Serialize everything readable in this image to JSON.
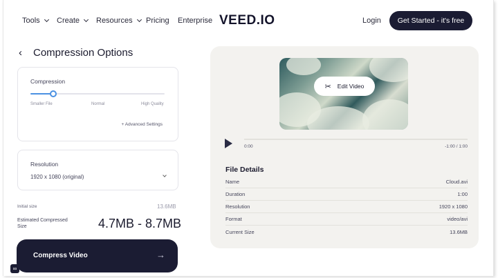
{
  "nav": {
    "tools": "Tools",
    "create": "Create",
    "resources": "Resources",
    "pricing": "Pricing",
    "enterprise": "Enterprise",
    "logo": "VEED.IO",
    "login": "Login",
    "get_started": "Get Started - it's free"
  },
  "left": {
    "title": "Compression Options",
    "compression": {
      "label": "Compression",
      "slider_fraction": 0.17,
      "ticks": [
        "Smaller File",
        "Normal",
        "High Quality"
      ],
      "advanced": "+ Advanced Settings"
    },
    "resolution": {
      "label": "Resolution",
      "selected": "1920 x 1080 (original)"
    },
    "initial_size_label": "Initial size",
    "initial_size_value": "13.6MB",
    "estimated_label": "Estimated Compressed Size",
    "estimated_value": "4.7MB - 8.7MB",
    "compress_button": "Compress Video"
  },
  "preview": {
    "edit_video": "Edit Video",
    "time_current": "0:00",
    "time_total": "-1:00 / 1:00"
  },
  "file_details": {
    "title": "File Details",
    "rows": [
      {
        "label": "Name",
        "value": "Cloud.avi"
      },
      {
        "label": "Duration",
        "value": "1:00"
      },
      {
        "label": "Resolution",
        "value": "1920 x 1080"
      },
      {
        "label": "Format",
        "value": "video/avi"
      },
      {
        "label": "Current Size",
        "value": "13.6MB"
      }
    ]
  },
  "colors": {
    "accent": "#4a90e2",
    "dark": "#1b1c33",
    "panel_bg": "#f3f2ef"
  }
}
